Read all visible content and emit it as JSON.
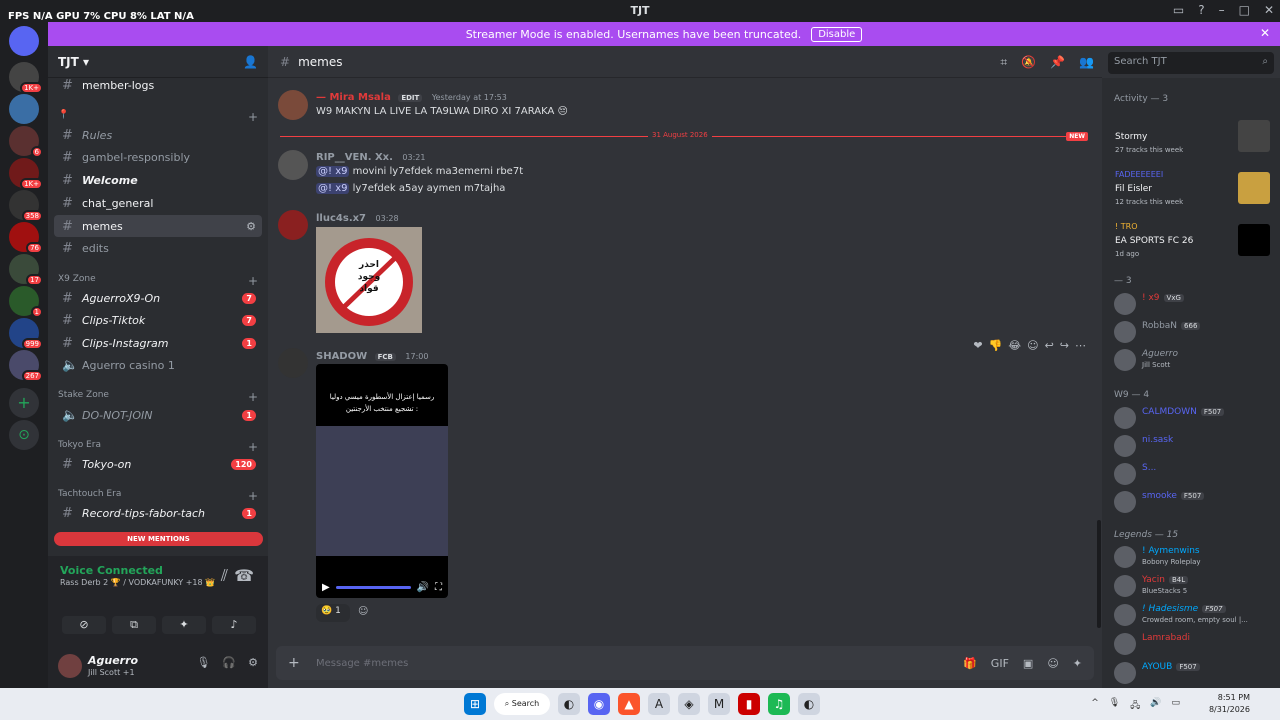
{
  "window": {
    "title": "TJT",
    "overlay_stats": "FPS N/A   GPU 7%   CPU 8%   LAT N/A"
  },
  "banner": {
    "text": "Streamer Mode is enabled. Usernames have been truncated.",
    "disable_label": "Disable"
  },
  "server_badges": [
    "1K+",
    "6",
    "1K+",
    "358",
    "76",
    "17",
    "1",
    "999",
    "267"
  ],
  "server": {
    "name": "TJT"
  },
  "channels": {
    "member_logs": "member-logs",
    "rules": "Rules",
    "gambel": "gambel-responsibly",
    "welcome": "Welcome",
    "chat_general": "chat_general",
    "memes": "memes",
    "edits": "edits",
    "x9_zone": "X9 Zone",
    "aguerro_on": "AguerroX9-On",
    "aguerro_count": "7",
    "clips_tiktok": "Clips-Tiktok",
    "tiktok_count": "7",
    "clips_instagram": "Clips-Instagram",
    "insta_count": "1",
    "casino": "Aguerro casino 1",
    "stake_zone": "Stake Zone",
    "do_not_join": "DO-NOT-JOIN",
    "dnj_count": "1",
    "tokyo_era": "Tokyo Era",
    "tokyo_on": "Tokyo-on",
    "tokyo_count": "120",
    "tachtouch_era": "Tachtouch Era",
    "record_tips": "Record-tips-fabor-tach",
    "record_count": "1",
    "new_mentions": "NEW MENTIONS"
  },
  "voice": {
    "status": "Voice Connected",
    "channel": "Rass Derb 2 🏆 / VODKAFUNKY +18 👑"
  },
  "user": {
    "name": "Aguerro",
    "status": "Jill Scott +1"
  },
  "chat": {
    "channel": "memes",
    "input_placeholder": "Message #memes",
    "messages": [
      {
        "name": "—  Mira Msala",
        "badge": "EDIT",
        "time": "Yesterday at 17:53",
        "text": "W9 MAKYN LA LIVE LA TA9LWA DIRO XI 7ARAKA 😔"
      },
      {
        "name": "RIP__VEN. Xx.",
        "time": "03:21",
        "lines": [
          "movini ly7efdek ma3emerni rbe7t",
          "ly7efdek a5ay aymen m7tajha"
        ],
        "mention": "@! x9"
      },
      {
        "name": "lluc4s.x7",
        "time": "03:28",
        "image_text": [
          "احذر",
          "وجود",
          "قواد"
        ]
      },
      {
        "name": "SHADOW",
        "tag": "FCB",
        "time": "17:00",
        "video_text": [
          "رسميا إعتزال الأسطورة ميسي دوليا",
          "تشجيع منتخب الأرجنتين :"
        ],
        "reaction": "🥹",
        "reaction_count": "1"
      }
    ],
    "divider": "31 August 2026",
    "new_label": "NEW"
  },
  "search": {
    "placeholder": "Search TJT"
  },
  "members": {
    "activity_header": "Activity — 3",
    "activities": [
      {
        "name": "Stormy",
        "sub": "27 tracks this week"
      },
      {
        "name": "Fil Eisler",
        "sub": "12 tracks this week",
        "badge": "FADEEEEEEI"
      },
      {
        "name": "EA SPORTS FC 26",
        "sub": "1d ago",
        "badge": "! TRO"
      }
    ],
    "group1": "— 3",
    "group1_members": [
      {
        "name": "! x9",
        "tag": "VxG",
        "sub": ""
      },
      {
        "name": "RobbaN",
        "tag": "666",
        "sub": ""
      },
      {
        "name": "Aguerro",
        "tag": "",
        "sub": "Jill Scott"
      }
    ],
    "group2": "W9 — 4",
    "group2_members": [
      {
        "name": "CALMDOWN",
        "tag": "F507",
        "sub": ""
      },
      {
        "name": "ni.sask",
        "tag": "",
        "sub": ""
      },
      {
        "name": "S...",
        "tag": "",
        "sub": ""
      },
      {
        "name": "smooke",
        "tag": "F507",
        "sub": ""
      }
    ],
    "legends": "Legends — 15",
    "legends_members": [
      {
        "name": "! Aymenwins",
        "tag": "",
        "sub": "Bobony Roleplay"
      },
      {
        "name": "Yacin",
        "tag": "B4L",
        "sub": "BlueStacks 5"
      },
      {
        "name": "! Hadesisme",
        "tag": "F507",
        "sub": "Crowded room, empty soul |..."
      },
      {
        "name": "Lamrabadi",
        "tag": "",
        "sub": ""
      },
      {
        "name": "AYOUB",
        "tag": "F507",
        "sub": ""
      }
    ]
  },
  "taskbar": {
    "search": "Search",
    "time": "8:51 PM",
    "date": "8/31/2026"
  }
}
